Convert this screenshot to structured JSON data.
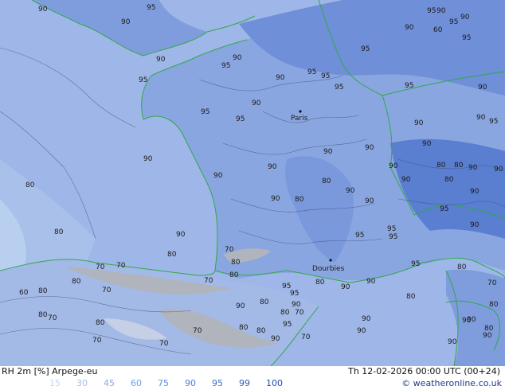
{
  "map": {
    "cities": [
      {
        "name": "Paris"
      },
      {
        "name": "Dourbies"
      }
    ],
    "contour_labels": [
      "90",
      "95",
      "90",
      "90",
      "95",
      "90",
      "95",
      "95",
      "95",
      "95",
      "90",
      "90",
      "95",
      "90",
      "95",
      "95",
      "90",
      "95",
      "90",
      "90",
      "95",
      "95",
      "90",
      "90",
      "95",
      "90",
      "90",
      "90",
      "90",
      "90",
      "90",
      "90",
      "80",
      "90",
      "80",
      "90",
      "90",
      "90",
      "80",
      "80",
      "90",
      "95",
      "90",
      "95",
      "80",
      "90",
      "80",
      "95",
      "95",
      "95",
      "80",
      "70",
      "70",
      "80",
      "80",
      "80",
      "70",
      "80",
      "60",
      "70",
      "80",
      "70",
      "80",
      "70",
      "80",
      "90",
      "95",
      "90",
      "80",
      "80",
      "70",
      "90",
      "95",
      "90",
      "90",
      "80",
      "70",
      "70",
      "80",
      "90",
      "95",
      "80",
      "90",
      "90",
      "90",
      "70",
      "70",
      "80",
      "80",
      "90",
      "70",
      "80",
      "80",
      "90",
      "90",
      "60",
      "90",
      "95"
    ],
    "colors": {
      "sea": "#9fb7e8",
      "land_90": "#8aa6e0",
      "land_95": "#6f8fd8",
      "land_99": "#5a7ed0",
      "dry_75": "#b8c7ea",
      "dry_60": "#c5d0e6",
      "dry_grey": "#b0b4bc",
      "coast": "#2fa84a",
      "border": "#2fa84a",
      "contour": "#3f4f7a"
    }
  },
  "footer": {
    "title_left": "RH 2m [%] Arpege-eu",
    "title_right": "Th 12-02-2026 00:00 UTC (00+24)",
    "legend": [
      {
        "label": "15",
        "color": "#c9d6ef"
      },
      {
        "label": "30",
        "color": "#a9bde6"
      },
      {
        "label": "45",
        "color": "#8aa6dd"
      },
      {
        "label": "60",
        "color": "#6ea0e6"
      },
      {
        "label": "75",
        "color": "#5a91e0"
      },
      {
        "label": "90",
        "color": "#4a80d8"
      },
      {
        "label": "95",
        "color": "#3d6fd0"
      },
      {
        "label": "99",
        "color": "#2d5bc4"
      },
      {
        "label": "100",
        "color": "#2048b8"
      }
    ],
    "credit": "© weatheronline.co.uk"
  }
}
